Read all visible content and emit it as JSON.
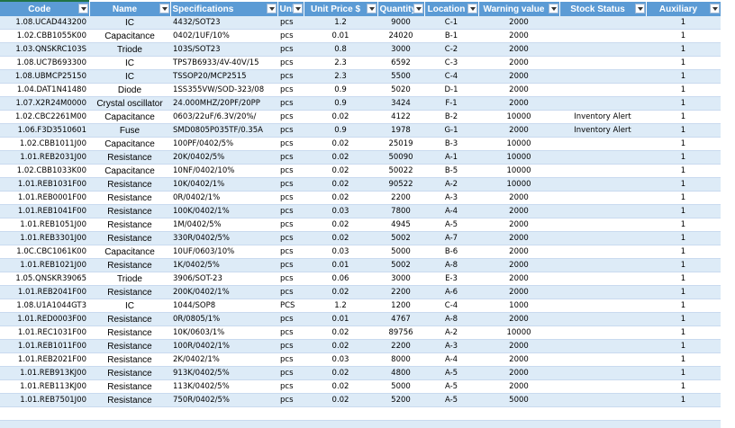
{
  "headers": [
    "Code",
    "Name",
    "Specifications",
    "Uni",
    "Unit Price $",
    "Quantity",
    "Location",
    "Warning value",
    "Stock Status",
    "Auxiliary"
  ],
  "rows": [
    [
      "1.08.UCAD443200",
      "IC",
      "4432/SOT23",
      "pcs",
      "1.2",
      "9000",
      "C-1",
      "2000",
      "",
      "1"
    ],
    [
      "1.02.CBB1055K00",
      "Capacitance",
      "0402/1UF/10%",
      "pcs",
      "0.01",
      "24020",
      "B-1",
      "2000",
      "",
      "1"
    ],
    [
      "1.03.QNSKRC103S",
      "Triode",
      "103S/SOT23",
      "pcs",
      "0.8",
      "3000",
      "C-2",
      "2000",
      "",
      "1"
    ],
    [
      "1.08.UC7B693300",
      "IC",
      "TPS7B6933/4V-40V/15",
      "pcs",
      "2.3",
      "6592",
      "C-3",
      "2000",
      "",
      "1"
    ],
    [
      "1.08.UBMCP25150",
      "IC",
      "TSSOP20/MCP2515",
      "pcs",
      "2.3",
      "5500",
      "C-4",
      "2000",
      "",
      "1"
    ],
    [
      "1.04.DAT1N41480",
      "Diode",
      "1SS355VW/SOD-323/08",
      "pcs",
      "0.9",
      "5020",
      "D-1",
      "2000",
      "",
      "1"
    ],
    [
      "1.07.X2R24M0000",
      "Crystal oscillator",
      "24.000MHZ/20PF/20PP",
      "pcs",
      "0.9",
      "3424",
      "F-1",
      "2000",
      "",
      "1"
    ],
    [
      "1.02.CBC2261M00",
      "Capacitance",
      "0603/22uF/6.3V/20%/",
      "pcs",
      "0.02",
      "4122",
      "B-2",
      "10000",
      "Inventory Alert",
      "1"
    ],
    [
      "1.06.F3D3510601",
      "Fuse",
      "SMD0805P035TF/0.35A",
      "pcs",
      "0.9",
      "1978",
      "G-1",
      "2000",
      "Inventory Alert",
      "1"
    ],
    [
      "1.02.CBB1011J00",
      "Capacitance",
      "100PF/0402/5%",
      "pcs",
      "0.02",
      "25019",
      "B-3",
      "10000",
      "",
      "1"
    ],
    [
      "1.01.REB2031J00",
      "Resistance",
      "20K/0402/5%",
      "pcs",
      "0.02",
      "50090",
      "A-1",
      "10000",
      "",
      "1"
    ],
    [
      "1.02.CBB1033K00",
      "Capacitance",
      "10NF/0402/10%",
      "pcs",
      "0.02",
      "50022",
      "B-5",
      "10000",
      "",
      "1"
    ],
    [
      "1.01.REB1031F00",
      "Resistance",
      "10K/0402/1%",
      "pcs",
      "0.02",
      "90522",
      "A-2",
      "10000",
      "",
      "1"
    ],
    [
      "1.01.REB0001F00",
      "Resistance",
      "0R/0402/1%",
      "pcs",
      "0.02",
      "2200",
      "A-3",
      "2000",
      "",
      "1"
    ],
    [
      "1.01.REB1041F00",
      "Resistance",
      "100K/0402/1%",
      "pcs",
      "0.03",
      "7800",
      "A-4",
      "2000",
      "",
      "1"
    ],
    [
      "1.01.REB1051J00",
      "Resistance",
      "1M/0402/5%",
      "pcs",
      "0.02",
      "4945",
      "A-5",
      "2000",
      "",
      "1"
    ],
    [
      "1.01.REB3301J00",
      "Resistance",
      "330R/0402/5%",
      "pcs",
      "0.02",
      "5002",
      "A-7",
      "2000",
      "",
      "1"
    ],
    [
      "1.0C.CBC1061K00",
      "Capacitance",
      "10UF/0603/10%",
      "pcs",
      "0.03",
      "5000",
      "B-6",
      "2000",
      "",
      "1"
    ],
    [
      "1.01.REB1021J00",
      "Resistance",
      "1K/0402/5%",
      "pcs",
      "0.01",
      "5002",
      "A-8",
      "2000",
      "",
      "1"
    ],
    [
      "1.05.QNSKR39065",
      "Triode",
      "3906/SOT-23",
      "pcs",
      "0.06",
      "3000",
      "E-3",
      "2000",
      "",
      "1"
    ],
    [
      "1.01.REB2041F00",
      "Resistance",
      "200K/0402/1%",
      "pcs",
      "0.02",
      "2200",
      "A-6",
      "2000",
      "",
      "1"
    ],
    [
      "1.08.U1A1044GT3",
      "IC",
      "1044/SOP8",
      "PCS",
      "1.2",
      "1200",
      "C-4",
      "1000",
      "",
      "1"
    ],
    [
      "1.01.RED0003F00",
      "Resistance",
      "0R/0805/1%",
      "pcs",
      "0.01",
      "4767",
      "A-8",
      "2000",
      "",
      "1"
    ],
    [
      "1.01.REC1031F00",
      "Resistance",
      "10K/0603/1%",
      "pcs",
      "0.02",
      "89756",
      "A-2",
      "10000",
      "",
      "1"
    ],
    [
      "1.01.REB1011F00",
      "Resistance",
      "100R/0402/1%",
      "pcs",
      "0.02",
      "2200",
      "A-3",
      "2000",
      "",
      "1"
    ],
    [
      "1.01.REB2021F00",
      "Resistance",
      "2K/0402/1%",
      "pcs",
      "0.03",
      "8000",
      "A-4",
      "2000",
      "",
      "1"
    ],
    [
      "1.01.REB913KJ00",
      "Resistance",
      "913K/0402/5%",
      "pcs",
      "0.02",
      "4800",
      "A-5",
      "2000",
      "",
      "1"
    ],
    [
      "1.01.REB113KJ00",
      "Resistance",
      "113K/0402/5%",
      "pcs",
      "0.02",
      "5000",
      "A-5",
      "2000",
      "",
      "1"
    ],
    [
      "1.01.REB7501J00",
      "Resistance",
      "750R/0402/5%",
      "pcs",
      "0.02",
      "5200",
      "A-5",
      "5000",
      "",
      "1"
    ]
  ],
  "colors": {
    "header_bg": "#5b9bd5",
    "band": "#ddebf7",
    "selection": "#217346"
  }
}
